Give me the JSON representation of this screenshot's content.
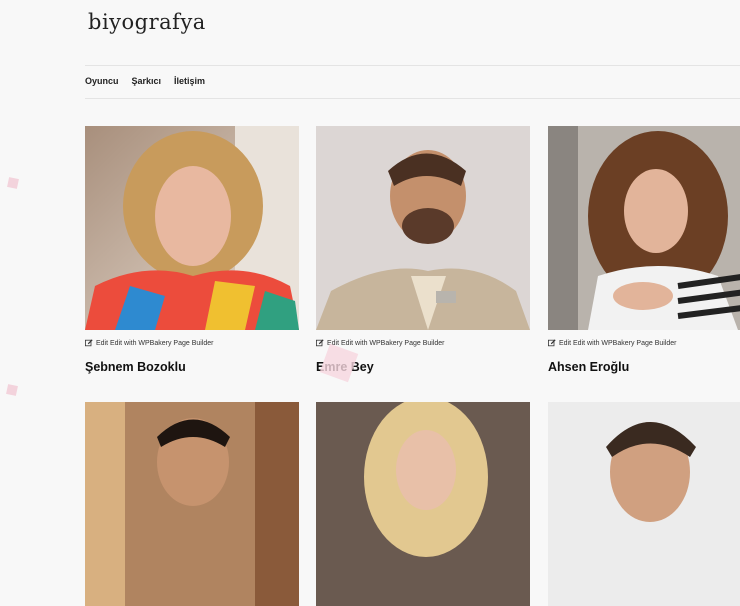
{
  "site": {
    "logo": "biyografya"
  },
  "nav": {
    "items": [
      "Oyuncu",
      "Şarkıcı",
      "İletişim"
    ]
  },
  "cards": [
    {
      "edit_label": "Edit Edit with WPBakery Page Builder",
      "name": "Şebnem Bozoklu"
    },
    {
      "edit_label": "Edit Edit with WPBakery Page Builder",
      "name": "Emre Bey"
    },
    {
      "edit_label": "Edit Edit with WPBakery Page Builder",
      "name": "Ahsen Eroğlu"
    }
  ],
  "colors": {
    "accent_deco": "#f3d3dc",
    "text": "#111111",
    "rule": "#e4e4e4"
  }
}
